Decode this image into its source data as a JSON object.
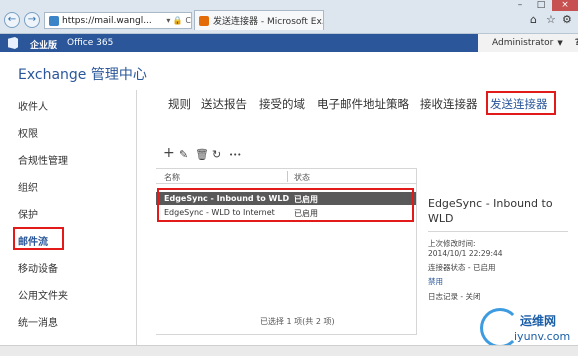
{
  "browser": {
    "address": "https://mail.wangl...",
    "address_controls": "▾ 🔒 C",
    "tab_title": "发送连接器 - Microsoft Ex...",
    "tab_close": "×",
    "back_icon": "arrow-left-icon",
    "forward_icon": "arrow-right-icon",
    "home_icon": "home-icon",
    "star_icon": "star-icon",
    "settings_icon": "gear-icon"
  },
  "topbar": {
    "enterprise_label": "企业版",
    "office365_label": "Office 365",
    "admin_label": "Administrator",
    "help_label": "?"
  },
  "header": {
    "title": "Exchange 管理中心"
  },
  "leftnav": {
    "items": [
      {
        "label": "收件人"
      },
      {
        "label": "权限"
      },
      {
        "label": "合规性管理"
      },
      {
        "label": "组织"
      },
      {
        "label": "保护"
      },
      {
        "label": "邮件流",
        "active": true
      },
      {
        "label": "移动设备"
      },
      {
        "label": "公用文件夹"
      },
      {
        "label": "统一消息"
      }
    ]
  },
  "subtabs": [
    {
      "label": "规则"
    },
    {
      "label": "送达报告"
    },
    {
      "label": "接受的域"
    },
    {
      "label": "电子邮件地址策略"
    },
    {
      "label": "接收连接器"
    },
    {
      "label": "发送连接器",
      "active": true
    }
  ],
  "toolbar": {
    "add": "+",
    "edit": "✎",
    "delete": "🗑",
    "refresh": "↻",
    "more": "•••"
  },
  "table": {
    "columns": [
      "名称",
      "状态"
    ],
    "rows": [
      {
        "name": "EdgeSync - Inbound to WLD",
        "status": "已启用",
        "selected": true
      },
      {
        "name": "EdgeSync - WLD to Internet",
        "status": "已启用",
        "selected": false
      }
    ],
    "footer": "已选择 1 项(共 2 项)"
  },
  "detail": {
    "title": "EdgeSync - Inbound to WLD",
    "modified_label": "上次修改时间:",
    "modified_value": "2014/10/1 22:29:44",
    "connector_status": "连接器状态 - 已启用",
    "disable_link": "禁用",
    "logging": "日志记录 - 关闭"
  },
  "watermark": {
    "brand": "运维网",
    "url": "iyunv.com"
  },
  "colors": {
    "accent": "#2b579a",
    "highlight_box": "#e21a1a",
    "selected_row": "#595959"
  }
}
